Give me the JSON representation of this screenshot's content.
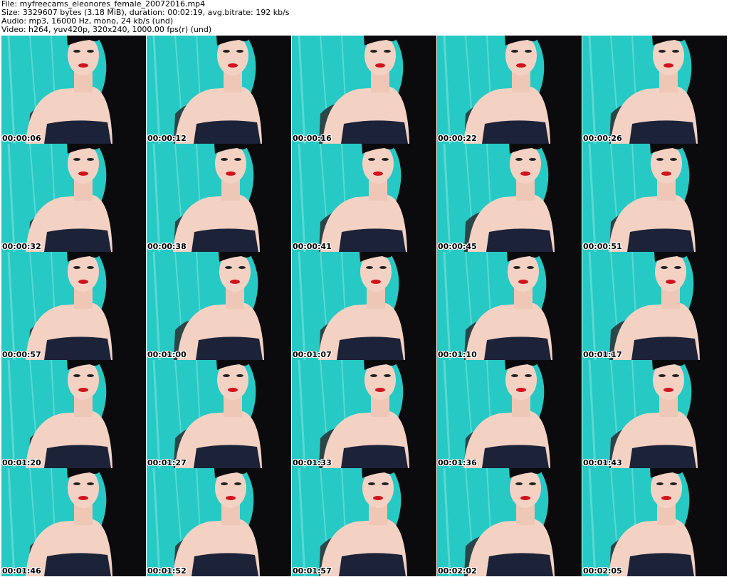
{
  "header": {
    "file_line": "File: myfreecams_eleonores_female_20072016.mp4",
    "size_line": "Size: 3329607 bytes (3.18 MiB), duration: 00:02:19, avg.bitrate: 192 kb/s",
    "audio_line": "Audio: mp3, 16000 Hz, mono, 24 kb/s (und)",
    "video_line": "Video: h264, yuv420p, 320x240, 1000.00 fps(r) (und)"
  },
  "colors": {
    "background_teal": "#26c9c4",
    "hair": "#0b0b0d",
    "skin": "#f3d2c3",
    "top": "#1c2238",
    "lips": "#d0141e"
  },
  "thumbnails": [
    {
      "timestamp": "00:00:06"
    },
    {
      "timestamp": "00:00:12"
    },
    {
      "timestamp": "00:00:16"
    },
    {
      "timestamp": "00:00:22"
    },
    {
      "timestamp": "00:00:26"
    },
    {
      "timestamp": "00:00:32"
    },
    {
      "timestamp": "00:00:38"
    },
    {
      "timestamp": "00:00:41"
    },
    {
      "timestamp": "00:00:45"
    },
    {
      "timestamp": "00:00:51"
    },
    {
      "timestamp": "00:00:57"
    },
    {
      "timestamp": "00:01:00"
    },
    {
      "timestamp": "00:01:07"
    },
    {
      "timestamp": "00:01:10"
    },
    {
      "timestamp": "00:01:17"
    },
    {
      "timestamp": "00:01:20"
    },
    {
      "timestamp": "00:01:27"
    },
    {
      "timestamp": "00:01:33"
    },
    {
      "timestamp": "00:01:36"
    },
    {
      "timestamp": "00:01:43"
    },
    {
      "timestamp": "00:01:46"
    },
    {
      "timestamp": "00:01:52"
    },
    {
      "timestamp": "00:01:57"
    },
    {
      "timestamp": "00:02:02"
    },
    {
      "timestamp": "00:02:05"
    }
  ]
}
